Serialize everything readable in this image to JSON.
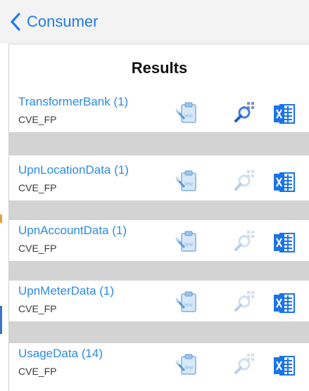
{
  "nav": {
    "back_label": "Consumer"
  },
  "panel": {
    "title": "Results"
  },
  "results": [
    {
      "name": "TransformerBank (1)",
      "sub": "CVE_FP",
      "search_enabled": true
    },
    {
      "name": "UpnLocationData (1)",
      "sub": "CVE_FP",
      "search_enabled": false
    },
    {
      "name": "UpnAccountData (1)",
      "sub": "CVE_FP",
      "search_enabled": false
    },
    {
      "name": "UpnMeterData (1)",
      "sub": "CVE_FP",
      "search_enabled": false
    },
    {
      "name": "UsageData (14)",
      "sub": "CVE_FP",
      "search_enabled": false
    }
  ],
  "icons": {
    "back": "chevron-left-icon",
    "view": "clipboard-view-icon",
    "search": "magnifier-grid-icon",
    "excel": "excel-icon"
  },
  "colors": {
    "accent": "#1e7cf2",
    "link": "#2a8be6",
    "separator": "#d3d3d3",
    "excel": "#1a73e8"
  }
}
